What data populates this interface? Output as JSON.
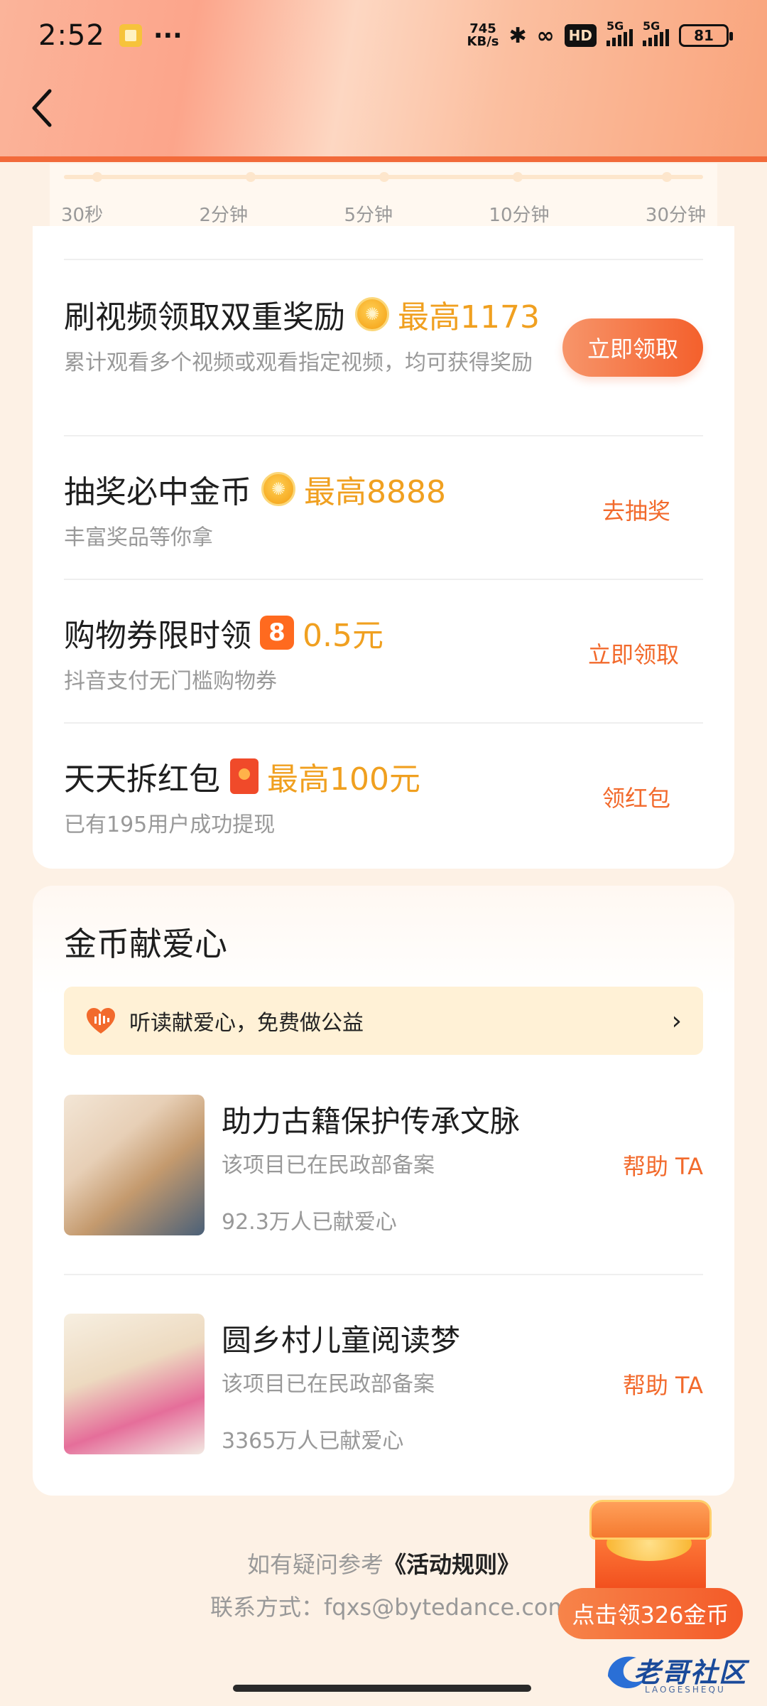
{
  "status_bar": {
    "time": "2:52",
    "net_speed_value": "745",
    "net_speed_unit": "KB/s",
    "hd": "HD",
    "sim1": "5G",
    "sim2": "5G",
    "battery": "81"
  },
  "slider": {
    "labels": [
      "30秒",
      "2分钟",
      "5分钟",
      "10分钟",
      "30分钟"
    ]
  },
  "tasks": [
    {
      "title": "刷视频领取双重奖励",
      "reward_icon": "coin-icon",
      "highlight": "最高1173",
      "subtitle": "累计观看多个视频或观看指定视频，均可获得奖励",
      "button": "立即领取",
      "button_style": "filled"
    },
    {
      "title": "抽奖必中金币",
      "reward_icon": "coin-icon",
      "highlight": "最高8888",
      "subtitle": "丰富奖品等你拿",
      "button": "去抽奖",
      "button_style": "text"
    },
    {
      "title": "购物券限时领",
      "reward_icon": "ticket-icon",
      "highlight": "0.5元",
      "subtitle": "抖音支付无门槛购物券",
      "button": "立即领取",
      "button_style": "text"
    },
    {
      "title": "天天拆红包",
      "reward_icon": "red-packet-icon",
      "highlight": "最高100元",
      "subtitle": "已有195用户成功提现",
      "button": "领红包",
      "button_style": "text"
    }
  ],
  "charity": {
    "title": "金币献爱心",
    "banner": "听读献爱心，免费做公益",
    "projects": [
      {
        "title": "助力古籍保护传承文脉",
        "subtitle": "该项目已在民政部备案",
        "count": "92.3万人已献爱心",
        "button": "帮助 TA"
      },
      {
        "title": "圆乡村儿童阅读梦",
        "subtitle": "该项目已在民政部备案",
        "count": "3365万人已献爱心",
        "button": "帮助 TA"
      }
    ]
  },
  "footer": {
    "rules_prefix": "如有疑问参考",
    "rules_link": "《活动规则》",
    "contact": "联系方式：fqxs@bytedance.com"
  },
  "floating": {
    "label": "点击领326金币"
  },
  "watermark": {
    "text": "老哥社区",
    "sub": "LAOGESHEQU"
  },
  "colors": {
    "accent": "#f26a2c",
    "highlight": "#f0a020",
    "header_bar": "#f26a3a"
  }
}
